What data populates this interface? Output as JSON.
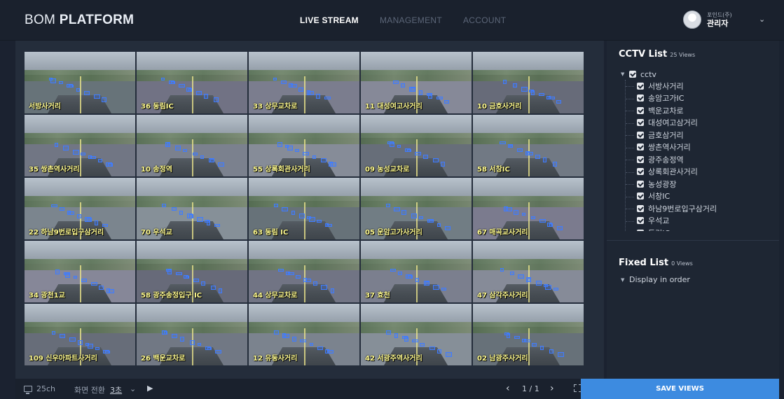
{
  "header": {
    "logo_light": "BOM ",
    "logo_bold": "PLATFORM",
    "nav": [
      "LIVE STREAM",
      "MANAGEMENT",
      "ACCOUNT"
    ],
    "active_nav": "LIVE STREAM",
    "user_company": "포인드(주)",
    "user_name": "관리자"
  },
  "cameras": [
    "서방사거리",
    "36 동림IC",
    "33 상무교차로",
    "11 대성여고사거리",
    "10 금호사거리",
    "35 쌍촌역사거리",
    "10 송정역",
    "55 상록회관사거리",
    "09 농성교차로",
    "58 서창IC",
    "22 하남9번로입구삼거리",
    "70 우석교",
    "63 동림 IC",
    "05 운암고가사거리",
    "67 매곡교사거리",
    "34 광천1교",
    "58 광주송정입구 IC",
    "44 상무교차로",
    "37 효천",
    "47 삼각주사거리",
    "109 신우아파트사거리",
    "26 백운교차로",
    "12 유동사거리",
    "42 서광주역사거리",
    "02 남광주사거리"
  ],
  "cctv": {
    "title": "CCTV List",
    "count": "25 Views",
    "root": "cctv",
    "items": [
      "서방사거리",
      "송암고가IC",
      "백운교차로",
      "대성여고삼거리",
      "금호삼거리",
      "쌍촌역사거리",
      "광주송정역",
      "상록회관사거리",
      "농성광장",
      "서창IC",
      "하남9번로입구삼거리",
      "우석교",
      "동림IC"
    ]
  },
  "fixed": {
    "title": "Fixed List",
    "count": "0 Views",
    "item": "Display in order"
  },
  "footer": {
    "channels": "25ch",
    "switch_label": "화면 전환",
    "interval": "3초",
    "page": "1 / 1"
  },
  "save_label": "SAVE VIEWS"
}
